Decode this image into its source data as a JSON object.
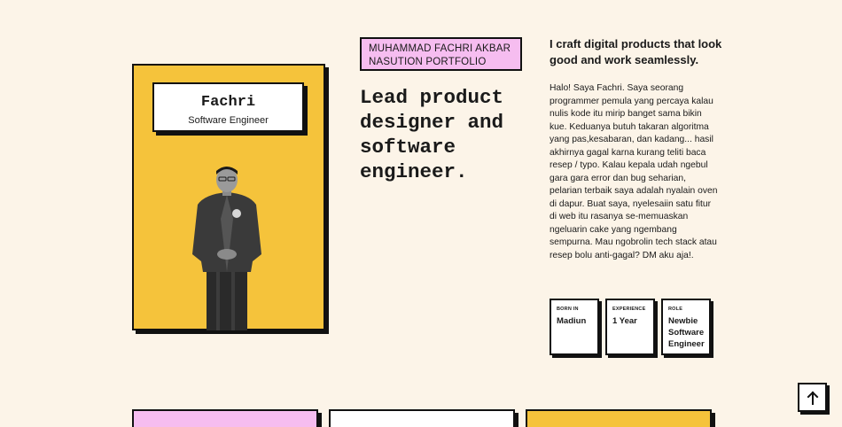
{
  "profile_card": {
    "name": "Fachri",
    "role": "Software Engineer"
  },
  "tag": "MUHAMMAD FACHRI AKBAR NASUTION PORTFOLIO",
  "headline": "Lead product designer and software engineer.",
  "lead": "I craft digital products that look good and work seamlessly.",
  "bio": "Halo! Saya Fachri. Saya seorang programmer pemula yang percaya kalau nulis kode itu mirip banget sama bikin kue. Keduanya butuh takaran algoritma yang pas,kesabaran, dan kadang... hasil akhirnya gagal karna kurang teliti baca resep / typo. Kalau kepala udah ngebul gara gara error dan bug seharian, pelarian terbaik saya adalah nyalain oven di dapur. Buat saya, nyelesaiin satu fitur di web itu rasanya se-memuaskan ngeluarin cake yang ngembang sempurna. Mau ngobrolin tech stack atau resep bolu anti-gagal? DM aku aja!.",
  "stats": [
    {
      "label": "BORN IN",
      "value": "Madiun"
    },
    {
      "label": "EXPERIENCE",
      "value": "1 Year"
    },
    {
      "label": "ROLE",
      "value": "Newbie Software Engineer"
    }
  ],
  "colors": {
    "background": "#fcf4e8",
    "yellow": "#f5c33b",
    "pink": "#f6bdf0",
    "white": "#ffffff",
    "ink": "#111111"
  },
  "icons": {
    "scroll_top": "arrow-up-icon"
  }
}
